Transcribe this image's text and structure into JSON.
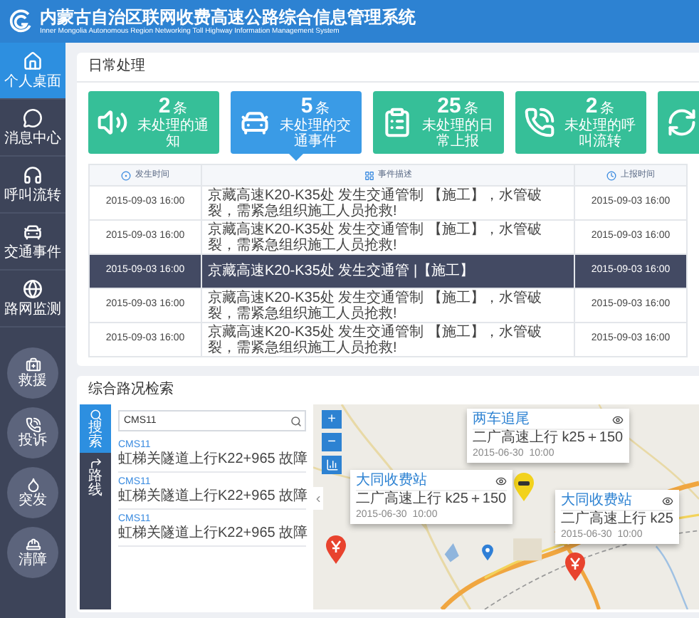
{
  "header": {
    "title": "内蒙古自治区联网收费高速公路综合信息管理系统",
    "subtitle": "Inner Mongolia Autonomous Region Networking Toll Highway Information Management System"
  },
  "sidebar": {
    "nav": [
      {
        "label": "个人桌面",
        "kind": "home",
        "selected": true
      },
      {
        "label": "消息中心",
        "kind": "chat",
        "selected": false
      },
      {
        "label": "呼叫流转",
        "kind": "headset",
        "selected": false
      },
      {
        "label": "交通事件",
        "kind": "cars",
        "selected": false
      },
      {
        "label": "路网监测",
        "kind": "globe",
        "selected": false
      }
    ],
    "quick": [
      {
        "label": "救援",
        "kind": "kit"
      },
      {
        "label": "投诉",
        "kind": "phone"
      },
      {
        "label": "突发",
        "kind": "drop"
      },
      {
        "label": "清障",
        "kind": "worker"
      }
    ]
  },
  "daily": {
    "title": "日常处理",
    "tiles": [
      {
        "kind": "speaker",
        "count": "2",
        "unit": "条",
        "label": "未处理的通知",
        "selected": false
      },
      {
        "kind": "cars",
        "count": "5",
        "unit": "条",
        "label": "未处理的交通事件",
        "selected": true
      },
      {
        "kind": "clipboard",
        "count": "25",
        "unit": "条",
        "label": "未处理的日常上报",
        "selected": false
      },
      {
        "kind": "phone",
        "count": "2",
        "unit": "条",
        "label": "未处理的呼叫流转",
        "selected": false
      },
      {
        "kind": "refresh",
        "selected": false
      }
    ],
    "table": {
      "columns": [
        {
          "label": "发生时间",
          "kind": "dot"
        },
        {
          "label": "事件描述",
          "kind": "grid"
        },
        {
          "label": "上报时间",
          "kind": "clock"
        }
      ],
      "rows": [
        {
          "cells": [
            "2015-09-03 16:00",
            "京藏高速K20-K35处 发生交通管制 【施工】，水管破裂，需紧急组织施工人员抢救!",
            "2015-09-03 16:00"
          ],
          "selected": false
        },
        {
          "cells": [
            "2015-09-03 16:00",
            "京藏高速K20-K35处 发生交通管制 【施工】，水管破裂，需紧急组织施工人员抢救!",
            "2015-09-03 16:00"
          ],
          "selected": false
        },
        {
          "cells": [
            "2015-09-03 16:00",
            "京藏高速K20-K35处 发生交通管 |【施工】",
            "2015-09-03 16:00"
          ],
          "selected": true
        },
        {
          "cells": [
            "2015-09-03 16:00",
            "京藏高速K20-K35处 发生交通管制 【施工】，水管破裂，需紧急组织施工人员抢救!",
            "2015-09-03 16:00"
          ],
          "selected": false
        },
        {
          "cells": [
            "2015-09-03 16:00",
            "京藏高速K20-K35处 发生交通管制 【施工】，水管破裂，需紧急组织施工人员抢救!",
            "2015-09-03 16:00"
          ],
          "selected": false
        }
      ]
    }
  },
  "search_panel": {
    "title": "综合路况检索",
    "tabs": [
      {
        "label": "搜索",
        "kind": "search",
        "selected": true
      },
      {
        "label": "路线",
        "kind": "route",
        "selected": false
      }
    ],
    "query": "CMS11",
    "results": [
      {
        "code": "CMS11",
        "text": "虹梯关隧道上行K22+965 故障"
      },
      {
        "code": "CMS11",
        "text": "虹梯关隧道上行K22+965 故障"
      },
      {
        "code": "CMS11",
        "text": "虹梯关隧道上行K22+965 故障"
      }
    ],
    "map": {
      "zoom_controls": [
        "+",
        "−"
      ],
      "markers": [
        {
          "kind": "accident"
        },
        {
          "kind": "toll"
        },
        {
          "kind": "point"
        },
        {
          "kind": "toll"
        }
      ],
      "popups": [
        {
          "title": "两车追尾",
          "road": "二广高速上行 k25＋150",
          "time": "2015-06-30  10:00"
        },
        {
          "title": "大同收费站",
          "road": "二广高速上行 k25＋150",
          "time": "2015-06-30  10:00"
        },
        {
          "title": "大同收费站",
          "road": "二广高速上行 k25",
          "time": "2015-06-30  10:00"
        }
      ]
    }
  }
}
